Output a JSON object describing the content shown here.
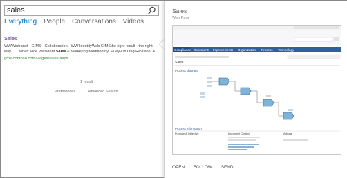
{
  "search": {
    "query": "sales"
  },
  "tabs": [
    "Everything",
    "People",
    "Conversations",
    "Videos"
  ],
  "result": {
    "title": "Sales",
    "snippet_before": "WWWintranet - GIMS - Collaboration - WW IdentityWeb GIMSthe right result - the right way ... Owner: Vice President ",
    "snippet_bold": "Sales",
    "snippet_after": " & Marketing Modified by: Huey-Lin.Ong Revision: 4 ...",
    "url": "gms.contoso.com/Pages/sales.aspx"
  },
  "result_count": "1 result",
  "footer_links": [
    "Preferences",
    "Advanced Search"
  ],
  "hover_panel": {
    "title": "Sales",
    "type": "Web Page",
    "actions": [
      "OPEN",
      "FOLLOW",
      "SEND"
    ]
  },
  "preview": {
    "nav_items": [
      "Compliance",
      "Documents",
      "Improvements",
      "Organization",
      "Process",
      "Technology"
    ],
    "page_heading": "Sales",
    "diagram_label": "Process diagram",
    "info_label": "Process information",
    "purpose_label": "Purpose & Objective",
    "doc_label": "Document Control",
    "actions_label": "Actions"
  },
  "colors": {
    "accent": "#0072c6",
    "title_purple": "#5b2a86",
    "url_green": "#3b8a3b",
    "preview_nav": "#2e5f9e"
  }
}
